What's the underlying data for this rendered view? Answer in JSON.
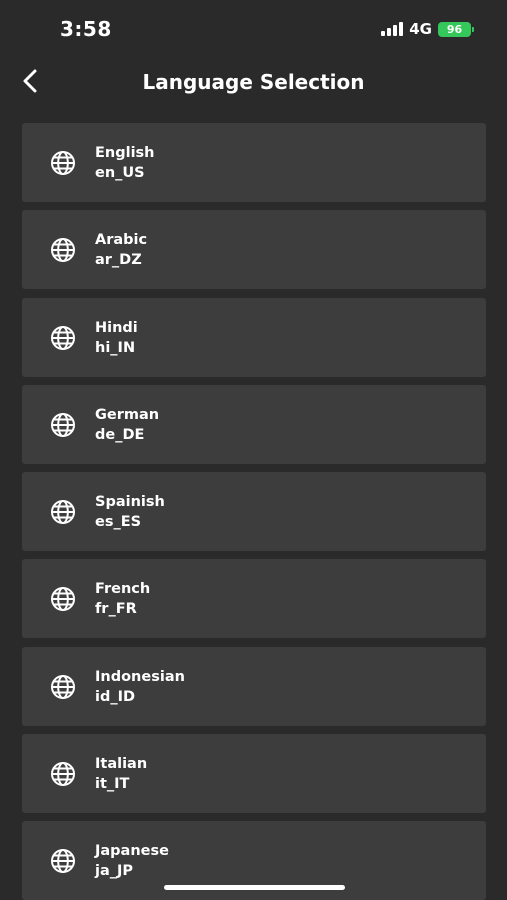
{
  "status_bar": {
    "time": "3:58",
    "network": "4G",
    "battery": "96",
    "battery_color": "#34c759"
  },
  "header": {
    "title": "Language Selection",
    "back_icon": "chevron-left-icon"
  },
  "languages": [
    {
      "name": "English",
      "code": "en_US",
      "icon": "globe-icon"
    },
    {
      "name": "Arabic",
      "code": "ar_DZ",
      "icon": "globe-icon"
    },
    {
      "name": "Hindi",
      "code": "hi_IN",
      "icon": "globe-icon"
    },
    {
      "name": "German",
      "code": "de_DE",
      "icon": "globe-icon"
    },
    {
      "name": "Spainish",
      "code": "es_ES",
      "icon": "globe-icon"
    },
    {
      "name": "French",
      "code": "fr_FR",
      "icon": "globe-icon"
    },
    {
      "name": "Indonesian",
      "code": "id_ID",
      "icon": "globe-icon"
    },
    {
      "name": "Italian",
      "code": "it_IT",
      "icon": "globe-icon"
    },
    {
      "name": "Japanese",
      "code": "ja_JP",
      "icon": "globe-icon"
    }
  ],
  "colors": {
    "background": "#2a2a2a",
    "card": "#3d3d3d",
    "text": "#ffffff"
  }
}
